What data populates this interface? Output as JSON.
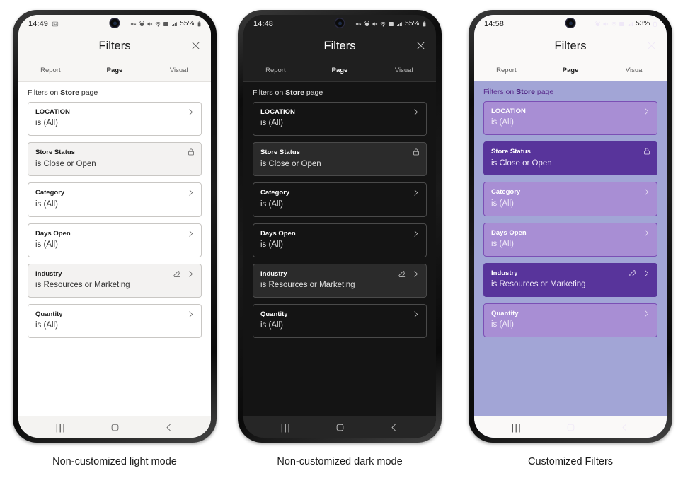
{
  "panels": [
    {
      "id": "light",
      "theme": "t-light",
      "caption": "Non-customized light mode",
      "status": {
        "time": "14:49",
        "left_icon": "image-icon",
        "icons": [
          "vpn-key-icon",
          "alarm-icon",
          "mute-icon",
          "wifi-icon",
          "nfc-icon",
          "signal-icon"
        ],
        "battery": "55%",
        "battery_icon": "battery-lock-icon"
      },
      "header": {
        "title": "Filters",
        "close_label": "close-icon"
      },
      "tabs": [
        {
          "label": "Report",
          "active": false
        },
        {
          "label": "Page",
          "active": true
        },
        {
          "label": "Visual",
          "active": false
        }
      ],
      "body": {
        "filters_on_prefix": "Filters on ",
        "filters_on_page": "Store",
        "filters_on_suffix": " page",
        "cards": [
          {
            "title": "LOCATION",
            "value": "is (All)",
            "state": "normal",
            "icons": [
              "chevron-right-icon"
            ]
          },
          {
            "title": "Store Status",
            "value": "is Close or Open",
            "state": "locked",
            "icons": [
              "lock-icon"
            ]
          },
          {
            "title": "Category",
            "value": "is (All)",
            "state": "normal",
            "icons": [
              "chevron-right-icon"
            ]
          },
          {
            "title": "Days Open",
            "value": "is (All)",
            "state": "normal",
            "icons": [
              "chevron-right-icon"
            ]
          },
          {
            "title": "Industry",
            "value": "is Resources or Marketing",
            "state": "applied",
            "icons": [
              "clear-filter-icon",
              "chevron-right-icon"
            ]
          },
          {
            "title": "Quantity",
            "value": "is (All)",
            "state": "normal",
            "icons": [
              "chevron-right-icon"
            ]
          }
        ]
      },
      "nav": {
        "recents": "|||",
        "home": "home-icon",
        "back": "back-icon"
      }
    },
    {
      "id": "dark",
      "theme": "t-dark",
      "caption": "Non-customized dark mode",
      "status": {
        "time": "14:48",
        "left_icon": "",
        "icons": [
          "vpn-key-icon",
          "alarm-icon",
          "mute-icon",
          "wifi-icon",
          "nfc-icon",
          "signal-icon"
        ],
        "battery": "55%",
        "battery_icon": "battery-lock-icon"
      },
      "header": {
        "title": "Filters",
        "close_label": "close-icon"
      },
      "tabs": [
        {
          "label": "Report",
          "active": false
        },
        {
          "label": "Page",
          "active": true
        },
        {
          "label": "Visual",
          "active": false
        }
      ],
      "body": {
        "filters_on_prefix": "Filters on ",
        "filters_on_page": "Store",
        "filters_on_suffix": " page",
        "cards": [
          {
            "title": "LOCATION",
            "value": "is (All)",
            "state": "normal",
            "icons": [
              "chevron-right-icon"
            ]
          },
          {
            "title": "Store Status",
            "value": "is Close or Open",
            "state": "locked",
            "icons": [
              "lock-icon"
            ]
          },
          {
            "title": "Category",
            "value": "is (All)",
            "state": "normal",
            "icons": [
              "chevron-right-icon"
            ]
          },
          {
            "title": "Days Open",
            "value": "is (All)",
            "state": "normal",
            "icons": [
              "chevron-right-icon"
            ]
          },
          {
            "title": "Industry",
            "value": "is Resources or Marketing",
            "state": "applied",
            "icons": [
              "clear-filter-icon",
              "chevron-right-icon"
            ]
          },
          {
            "title": "Quantity",
            "value": "is (All)",
            "state": "normal",
            "icons": [
              "chevron-right-icon"
            ]
          }
        ]
      },
      "nav": {
        "recents": "|||",
        "home": "home-icon",
        "back": "back-icon"
      }
    },
    {
      "id": "custom",
      "theme": "t-custom",
      "caption": "Customized Filters",
      "status": {
        "time": "14:58",
        "left_icon": "",
        "icons": [
          "alarm-icon",
          "mute-icon",
          "wifi-icon",
          "nfc-icon",
          "signal-icon"
        ],
        "battery": "53%",
        "battery_icon": "battery-icon"
      },
      "header": {
        "title": "Filters",
        "close_label": "close-icon"
      },
      "tabs": [
        {
          "label": "Report",
          "active": false
        },
        {
          "label": "Page",
          "active": true
        },
        {
          "label": "Visual",
          "active": false
        }
      ],
      "body": {
        "filters_on_prefix": "Filters on ",
        "filters_on_page": "Store",
        "filters_on_suffix": " page",
        "cards": [
          {
            "title": "LOCATION",
            "value": "is (All)",
            "state": "normal",
            "icons": [
              "chevron-right-icon"
            ]
          },
          {
            "title": "Store Status",
            "value": "is Close or Open",
            "state": "locked",
            "icons": [
              "lock-icon"
            ]
          },
          {
            "title": "Category",
            "value": "is (All)",
            "state": "normal",
            "icons": [
              "chevron-right-icon"
            ]
          },
          {
            "title": "Days Open",
            "value": "is (All)",
            "state": "normal",
            "icons": [
              "chevron-right-icon"
            ]
          },
          {
            "title": "Industry",
            "value": "is Resources or Marketing",
            "state": "applied",
            "icons": [
              "clear-filter-icon",
              "chevron-right-icon"
            ]
          },
          {
            "title": "Quantity",
            "value": "is (All)",
            "state": "normal",
            "icons": [
              "chevron-right-icon"
            ]
          }
        ]
      },
      "nav": {
        "recents": "|||",
        "home": "home-icon",
        "back": "back-icon"
      }
    }
  ],
  "colors": {
    "custom_background": "#a2a5d6",
    "custom_card": "#a88ed4",
    "custom_card_active": "#58349b",
    "custom_card_border": "#7b4fb5",
    "custom_heading_text": "#5b2d8e",
    "dark_background": "#141414",
    "dark_card_active": "#2b2b2b",
    "light_background": "#ffffff",
    "light_card_active": "#f3f2f1"
  }
}
